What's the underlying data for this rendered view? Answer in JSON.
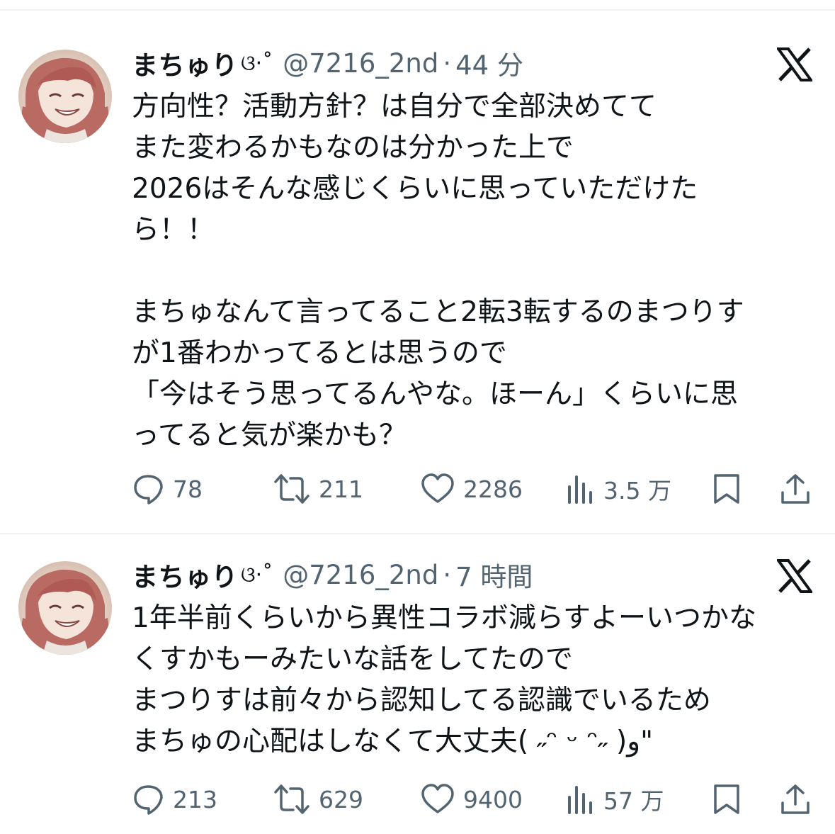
{
  "tweets": [
    {
      "author": {
        "display_name": "まちゅり",
        "name_decoration": "ଓ·˚",
        "handle": "@7216_2nd",
        "avatar_icon": "anime-girl-avatar"
      },
      "separator": "·",
      "timestamp": "44 分",
      "platform_icon": "x-logo-icon",
      "body_lines": [
        "方向性？活動方針？は自分で全部決めてて",
        "また変わるかもなのは分かった上で",
        "2026はそんな感じくらいに思っていただけた",
        "ら！！",
        "",
        "まちゅなんて言ってること2転3転するのまつりす",
        "が1番わかってるとは思うので",
        "「今はそう思ってるんやな。ほーん」くらいに思",
        "ってると気が楽かも？"
      ],
      "stats": {
        "replies": "78",
        "retweets": "211",
        "likes": "2286",
        "views": "3.5 万"
      }
    },
    {
      "author": {
        "display_name": "まちゅり",
        "name_decoration": "ଓ·˚",
        "handle": "@7216_2nd",
        "avatar_icon": "anime-girl-avatar"
      },
      "separator": "·",
      "timestamp": "7 時間",
      "platform_icon": "x-logo-icon",
      "body_lines": [
        "1年半前くらいから異性コラボ減らすよーいつかな",
        "くすかもーみたいな話をしてたので",
        "まつりすは前々から認知してる認識でいるため",
        "まちゅの心配はしなくて大丈夫( ˶ᵔ ᵕ ᵔ˶ )و\""
      ],
      "stats": {
        "replies": "213",
        "retweets": "629",
        "likes": "9400",
        "views": "57 万"
      }
    }
  ],
  "colors": {
    "text_primary": "#0f1419",
    "text_secondary": "#536471",
    "divider": "#eff3f4"
  }
}
